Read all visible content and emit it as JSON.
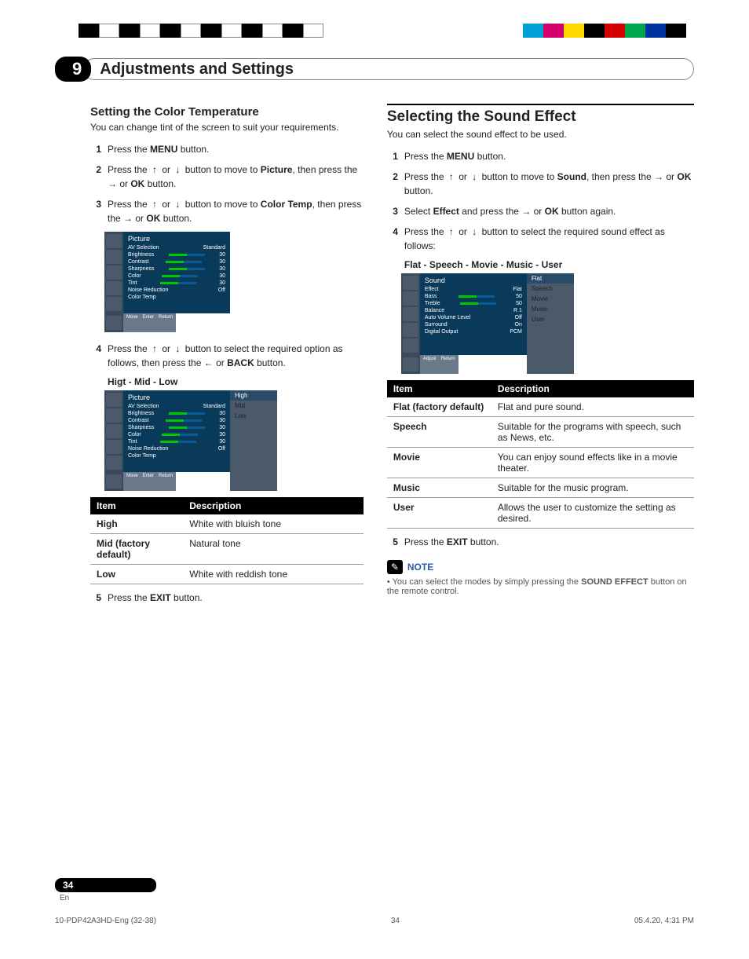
{
  "section": {
    "number": "9",
    "title": "Adjustments and Settings"
  },
  "left": {
    "heading": "Setting the Color Temperature",
    "intro": "You can change tint of the screen to suit your requirements.",
    "steps": [
      {
        "n": "1",
        "parts": [
          "Press the ",
          {
            "b": "MENU"
          },
          " button."
        ]
      },
      {
        "n": "2",
        "parts": [
          "Press the ",
          {
            "a": "↑"
          },
          " or ",
          {
            "a": "↓"
          },
          " button to move to ",
          {
            "b": "Picture"
          },
          ", then press the ",
          {
            "a": "→"
          },
          " or ",
          {
            "b": "OK"
          },
          " button."
        ]
      },
      {
        "n": "3",
        "parts": [
          "Press the ",
          {
            "a": "↑"
          },
          " or ",
          {
            "a": "↓"
          },
          " button to move to ",
          {
            "b": "Color Temp"
          },
          ", then press the ",
          {
            "a": "→"
          },
          " or ",
          {
            "b": "OK"
          },
          " button."
        ]
      }
    ],
    "osd1": {
      "title": "Picture",
      "items": [
        [
          "AV Selection",
          "Standard"
        ],
        [
          "Brightness",
          "30"
        ],
        [
          "Contrast",
          "30"
        ],
        [
          "Sharpness",
          "30"
        ],
        [
          "Color",
          "30"
        ],
        [
          "Tint",
          "30"
        ],
        [
          "Noise Reduction",
          "Off"
        ],
        [
          "Color Temp",
          ""
        ]
      ],
      "footer": [
        "Move",
        "Enter",
        "Return"
      ]
    },
    "step4": {
      "n": "4",
      "parts": [
        "Press the ",
        {
          "a": "↑"
        },
        " or ",
        {
          "a": "↓"
        },
        " button to select the required option as follows, then press the ",
        {
          "a": "←"
        },
        " or ",
        {
          "b": "BACK"
        },
        " button."
      ]
    },
    "options_line": "Higt - Mid - Low",
    "osd2_popup": [
      "High",
      "Mid",
      "Low"
    ],
    "table_header": [
      "Item",
      "Description"
    ],
    "table_rows": [
      [
        "High",
        "White with bluish tone"
      ],
      [
        "Mid (factory default)",
        "Natural tone"
      ],
      [
        "Low",
        "White with reddish tone"
      ]
    ],
    "step5": {
      "n": "5",
      "parts": [
        "Press the ",
        {
          "b": "EXIT"
        },
        " button."
      ]
    }
  },
  "right": {
    "heading": "Selecting the Sound Effect",
    "intro": "You can select the sound effect to be used.",
    "steps": [
      {
        "n": "1",
        "parts": [
          "Press the ",
          {
            "b": "MENU"
          },
          " button."
        ]
      },
      {
        "n": "2",
        "parts": [
          "Press the ",
          {
            "a": "↑"
          },
          " or ",
          {
            "a": "↓"
          },
          " button to move to ",
          {
            "b": "Sound"
          },
          ", then press the ",
          {
            "a": "→"
          },
          " or ",
          {
            "b": "OK"
          },
          " button."
        ]
      },
      {
        "n": "3",
        "parts": [
          "Select ",
          {
            "b": "Effect"
          },
          " and press the ",
          {
            "a": "→"
          },
          " or ",
          {
            "b": "OK"
          },
          " button again."
        ]
      },
      {
        "n": "4",
        "parts": [
          "Press the ",
          {
            "a": "↑"
          },
          " or ",
          {
            "a": "↓"
          },
          " button to select the required sound effect as follows:"
        ]
      }
    ],
    "options_line": "Flat - Speech - Movie - Music - User",
    "osd": {
      "title": "Sound",
      "items": [
        [
          "Effect",
          "Flat"
        ],
        [
          "Bass",
          "50"
        ],
        [
          "Treble",
          "50"
        ],
        [
          "Balance",
          "R 1"
        ],
        [
          "Auto Volume Level",
          "Off"
        ],
        [
          "Surround",
          "On"
        ],
        [
          "Digital Output",
          "PCM"
        ]
      ],
      "popup": [
        "Flat",
        "Speech",
        "Movie",
        "Music",
        "User"
      ],
      "footer": [
        "Adjust",
        "Return"
      ]
    },
    "table_header": [
      "Item",
      "Description"
    ],
    "table_rows": [
      [
        "Flat (factory default)",
        "Flat and pure sound."
      ],
      [
        "Speech",
        "Suitable for the programs with speech, such as News, etc."
      ],
      [
        "Movie",
        "You can enjoy sound effects like in a movie theater."
      ],
      [
        "Music",
        "Suitable for the music program."
      ],
      [
        "User",
        "Allows the user to customize the setting as desired."
      ]
    ],
    "step5": {
      "n": "5",
      "parts": [
        "Press the ",
        {
          "b": "EXIT"
        },
        " button."
      ]
    },
    "note_label": "NOTE",
    "note_bullets": [
      {
        "parts": [
          "You can select the modes by simply pressing the ",
          {
            "b": "SOUND EFFECT"
          },
          " button on the remote control."
        ]
      }
    ]
  },
  "footer": {
    "page_num": "34",
    "lang": "En",
    "file_ref": "10-PDP42A3HD-Eng (32-38)",
    "mid_num": "34",
    "timestamp": "05.4.20, 4:31 PM"
  }
}
